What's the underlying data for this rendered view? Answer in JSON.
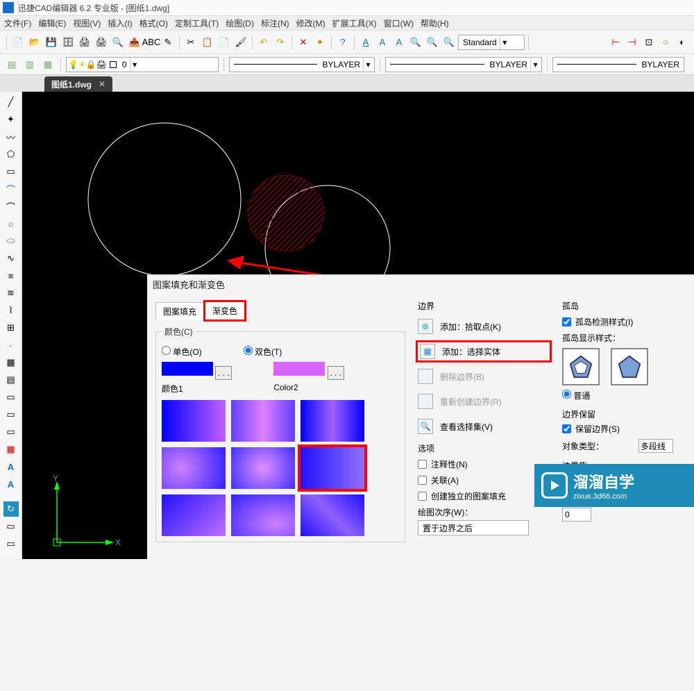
{
  "title": "迅捷CAD编辑器 6.2 专业版 - [图纸1.dwg]",
  "menu": [
    "文件(F)",
    "编辑(E)",
    "视图(V)",
    "插入(I)",
    "格式(O)",
    "定制工具(T)",
    "绘图(D)",
    "标注(N)",
    "修改(M)",
    "扩展工具(X)",
    "窗口(W)",
    "帮助(H)"
  ],
  "layer": {
    "num": "0"
  },
  "props": {
    "bylayer": "BYLAYER",
    "style": "Standard"
  },
  "tab": {
    "name": "图纸1.dwg",
    "close": "✕"
  },
  "dialog": {
    "title": "图案填充和渐变色",
    "tab_pattern": "图案填充",
    "tab_gradient": "渐变色",
    "colors_title": "颜色(C)",
    "single": "单色(O)",
    "double": "双色(T)",
    "c1": "颜色1",
    "c2": "Color2",
    "ell": ". . .",
    "boundary": {
      "title": "边界",
      "pick": "添加：拾取点(K)",
      "select": "添加：选择实体",
      "delete": "删除边界(B)",
      "rebuild": "重新创建边界(R)",
      "view": "查看选择集(V)"
    },
    "options": {
      "title": "选项",
      "anno": "注释性(N)",
      "assoc": "关联(A)",
      "indep": "创建独立的图案填充",
      "order_label": "绘图次序(W)：",
      "order_value": "置于边界之后"
    },
    "islands": {
      "title": "孤岛",
      "detect": "孤岛检测样式(I)",
      "display": "孤岛显示样式：",
      "normal": "普通"
    },
    "retain": {
      "title": "边界保留",
      "keep": "保留边界(S)",
      "objtype": "对象类型：",
      "objvalue": "多段线"
    },
    "bset": "边界集",
    "zero": "0"
  },
  "ucs": {
    "x": "X",
    "y": "Y"
  },
  "watermark": {
    "big": "溜溜自学",
    "sm": "zixue.3d66.com"
  }
}
